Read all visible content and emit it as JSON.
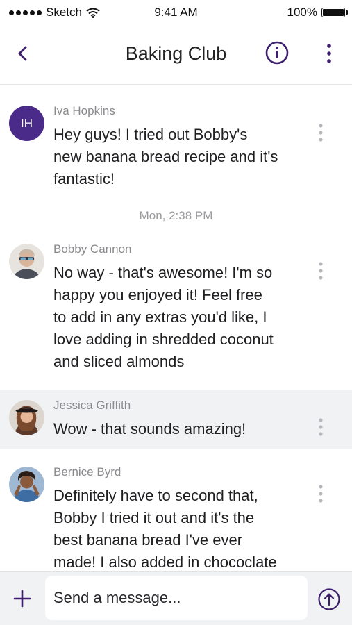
{
  "status_bar": {
    "carrier": "Sketch",
    "time": "9:41 AM",
    "battery_text": "100%",
    "battery_level": 1.0
  },
  "header": {
    "title": "Baking Club",
    "back_icon": "chevron-left-icon",
    "info_icon": "info-circle-icon",
    "menu_icon": "vertical-dots-icon",
    "accent_color": "#3d1f6e"
  },
  "messages": [
    {
      "sender": "Iva Hopkins",
      "initials": "IH",
      "lines": [
        "Hey guys! I tried out Bobby's",
        "new banana bread recipe and it's",
        "fantastic!"
      ]
    },
    {
      "timestamp": "Mon, 2:38 PM"
    },
    {
      "sender": "Bobby Cannon",
      "lines": [
        "No way - that's awesome! I'm so",
        "happy you enjoyed it! Feel free",
        "to add in any extras you'd like, I",
        "love adding in shredded coconut",
        "and sliced almonds"
      ]
    },
    {
      "sender": "Jessica Griffith",
      "lines": [
        "Wow - that sounds amazing!"
      ],
      "highlighted": true
    },
    {
      "sender": "Bernice Byrd",
      "lines": [
        "Definitely have to second that,",
        "Bobby I tried it out and it's the",
        "best banana bread I've ever",
        "made! I also added in chococlate"
      ]
    }
  ],
  "composer": {
    "placeholder": "Send a message...",
    "value": "",
    "plus_icon": "plus-icon",
    "send_icon": "send-arrow-up-icon"
  },
  "colors": {
    "initials_avatar": "#4b2b8a",
    "highlight_row": "#f1f2f4"
  }
}
